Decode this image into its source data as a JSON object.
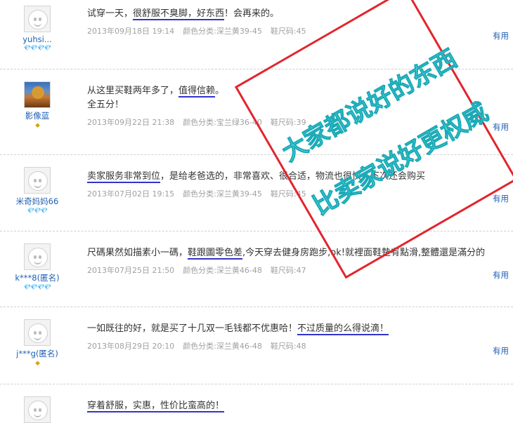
{
  "reviews": [
    {
      "user": "yuhsi...",
      "avatar": "default",
      "badge": "💎💎💎💎",
      "badge_color": "red",
      "text_parts": [
        {
          "t": "试穿一天，",
          "u": false
        },
        {
          "t": "很舒服不臭脚，好东西",
          "u": true
        },
        {
          "t": "！会再来的。",
          "u": false
        }
      ],
      "line2": "",
      "date": "2013年09月18日 19:14",
      "color_class": "颜色分类:深兰黄39-45",
      "size": "鞋尺码:45",
      "useful": "有用"
    },
    {
      "user": "影像蓝",
      "avatar": "photo",
      "badge": "◆",
      "badge_color": "gold",
      "text_parts": [
        {
          "t": "从这里买鞋两年多了，",
          "u": false
        },
        {
          "t": "值得信赖",
          "u": true
        },
        {
          "t": "。",
          "u": false
        }
      ],
      "line2": "全五分！",
      "date": "2013年09月22日 21:38",
      "color_class": "颜色分类:宝兰绿36-40",
      "size": "鞋尺码:39",
      "useful": "有用"
    },
    {
      "user": "米奇妈妈66",
      "avatar": "default",
      "badge": "💎💎💎",
      "badge_color": "red",
      "text_parts": [
        {
          "t": "卖家服务非常到位",
          "u": true
        },
        {
          "t": "，是给老爸选的，非常喜欢、很合适，物流也很快，下次还会购买",
          "u": false
        }
      ],
      "line2": "",
      "date": "2013年07月02日 19:15",
      "color_class": "颜色分类:深兰黄39-45",
      "size": "鞋尺码:45",
      "useful": "有用"
    },
    {
      "user": "k***8(匿名)",
      "avatar": "default",
      "badge": "💎💎💎💎",
      "badge_color": "red",
      "text_parts": [
        {
          "t": "尺碼果然如描素小一碼，",
          "u": false
        },
        {
          "t": "鞋跟圖零色差",
          "u": true
        },
        {
          "t": ",今天穿去健身房跑步,ok!就裡面鞋墊有點滑,整體還是滿分的",
          "u": false
        }
      ],
      "line2": "",
      "date": "2013年07月25日 21:50",
      "color_class": "颜色分类:深兰黄46-48",
      "size": "鞋尺码:47",
      "useful": "有用"
    },
    {
      "user": "j***g(匿名)",
      "avatar": "default",
      "badge": "◆",
      "badge_color": "gold",
      "text_parts": [
        {
          "t": "一如既往的好，就是买了十几双一毛钱都不优惠哈！",
          "u": false
        },
        {
          "t": "不过质量的么得说滴！",
          "u": true
        }
      ],
      "line2": "",
      "date": "2013年08月29日 20:10",
      "color_class": "颜色分类:深兰黄46-48",
      "size": "鞋尺码:48",
      "useful": "有用"
    },
    {
      "user": "",
      "avatar": "default",
      "badge": "",
      "badge_color": "red",
      "text_parts": [
        {
          "t": "穿着舒服，实惠，性价比蛮高的！",
          "u": true
        }
      ],
      "line2": "",
      "date": "",
      "color_class": "",
      "size": "",
      "useful": ""
    }
  ],
  "stamp": {
    "line1": "大家都说好的东西",
    "line2": "比卖家说好更权威"
  }
}
